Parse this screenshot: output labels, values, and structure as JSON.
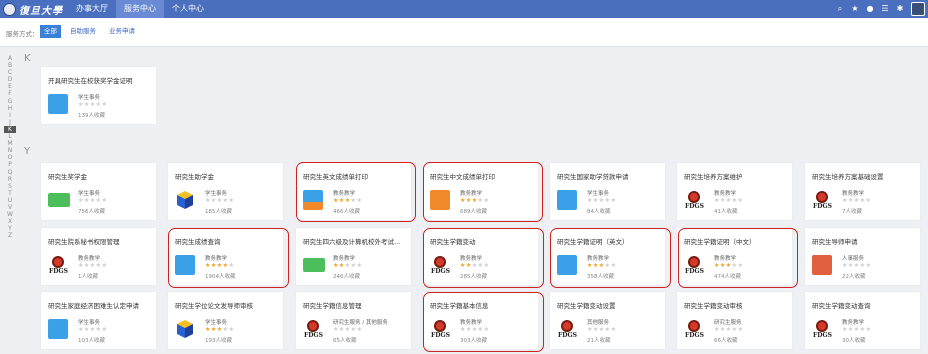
{
  "header": {
    "logo_text": "復旦大學",
    "nav": [
      "办事大厅",
      "服务中心",
      "个人中心"
    ]
  },
  "filter": {
    "label": "服务方式：",
    "options": [
      "全部",
      "自助服务",
      "业务申请"
    ]
  },
  "alphabet": [
    "A",
    "B",
    "C",
    "D",
    "E",
    "F",
    "G",
    "H",
    "I",
    "J",
    "K",
    "L",
    "M",
    "N",
    "O",
    "P",
    "Q",
    "R",
    "S",
    "T",
    "U",
    "V",
    "W",
    "X",
    "Y",
    "Z"
  ],
  "sections": {
    "k_letter": "K",
    "y_letter": "Y"
  },
  "cards": [
    {
      "title": "开具研究生在校获奖学金证明",
      "cat": "学生事务",
      "stars": 0,
      "fav": "139人收藏"
    },
    {
      "title": "研究生奖学金",
      "cat": "学生事务",
      "stars": 0,
      "fav": "756人收藏"
    },
    {
      "title": "研究生助学金",
      "cat": "学生事务",
      "stars": 0,
      "fav": "185人收藏"
    },
    {
      "title": "研究生英文成绩单打印",
      "cat": "教务教学",
      "stars": 3,
      "fav": "466人收藏"
    },
    {
      "title": "研究生中文成绩单打印",
      "cat": "教务教学",
      "stars": 2.5,
      "fav": "689人收藏"
    },
    {
      "title": "研究生国家助学贷款申请",
      "cat": "学生事务",
      "stars": 0,
      "fav": "84人收藏"
    },
    {
      "title": "研究生培养方案维护",
      "cat": "教务教学",
      "stars": 0,
      "fav": "41人收藏"
    },
    {
      "title": "研究生培养方案基础设置",
      "cat": "教务教学",
      "stars": 0,
      "fav": "7人收藏"
    },
    {
      "title": "研究生院系秘书权限管理",
      "cat": "教务教学",
      "stars": 0,
      "fav": "1人收藏"
    },
    {
      "title": "研究生成绩查询",
      "cat": "教务教学",
      "stars": 3.5,
      "fav": "1904人收藏"
    },
    {
      "title": "研究生四六级及计算机校外考试...",
      "cat": "教务教学",
      "stars": 2,
      "fav": "246人收藏"
    },
    {
      "title": "研究生学籍变动",
      "cat": "教务教学",
      "stars": 2,
      "fav": "285人收藏"
    },
    {
      "title": "研究生学籍证明（英文）",
      "cat": "教务教学",
      "stars": 2.5,
      "fav": "358人收藏"
    },
    {
      "title": "研究生学籍证明（中文）",
      "cat": "教务教学",
      "stars": 3,
      "fav": "474人收藏"
    },
    {
      "title": "研究生导师申请",
      "cat": "人事服务",
      "stars": 0,
      "fav": "22人收藏"
    },
    {
      "title": "研究生家庭经济困难生认定申请",
      "cat": "学生事务",
      "stars": 0,
      "fav": "103人收藏"
    },
    {
      "title": "研究生学位论文发导师审核",
      "cat": "学生事务",
      "stars": 3,
      "fav": "193人收藏"
    },
    {
      "title": "研究生学籍信息管理",
      "cat": "研究生服务 / 其他服务",
      "stars": 0,
      "fav": "65人收藏"
    },
    {
      "title": "研究生学籍基本信息",
      "cat": "教务教学",
      "stars": 0,
      "fav": "303人收藏"
    },
    {
      "title": "研究生学籍变动设置",
      "cat": "其他服务",
      "stars": 0,
      "fav": "21人收藏"
    },
    {
      "title": "研究生学籍变动审核",
      "cat": "研究生服务",
      "stars": 0,
      "fav": "66人收藏"
    },
    {
      "title": "研究生学籍变动查询",
      "cat": "教务教学",
      "stars": 0,
      "fav": "30人收藏"
    }
  ],
  "fdgs_label": "FDGS",
  "colors": {
    "topbar": "#4a6fbf",
    "highlight": "#d02020",
    "star": "#f0a020"
  }
}
